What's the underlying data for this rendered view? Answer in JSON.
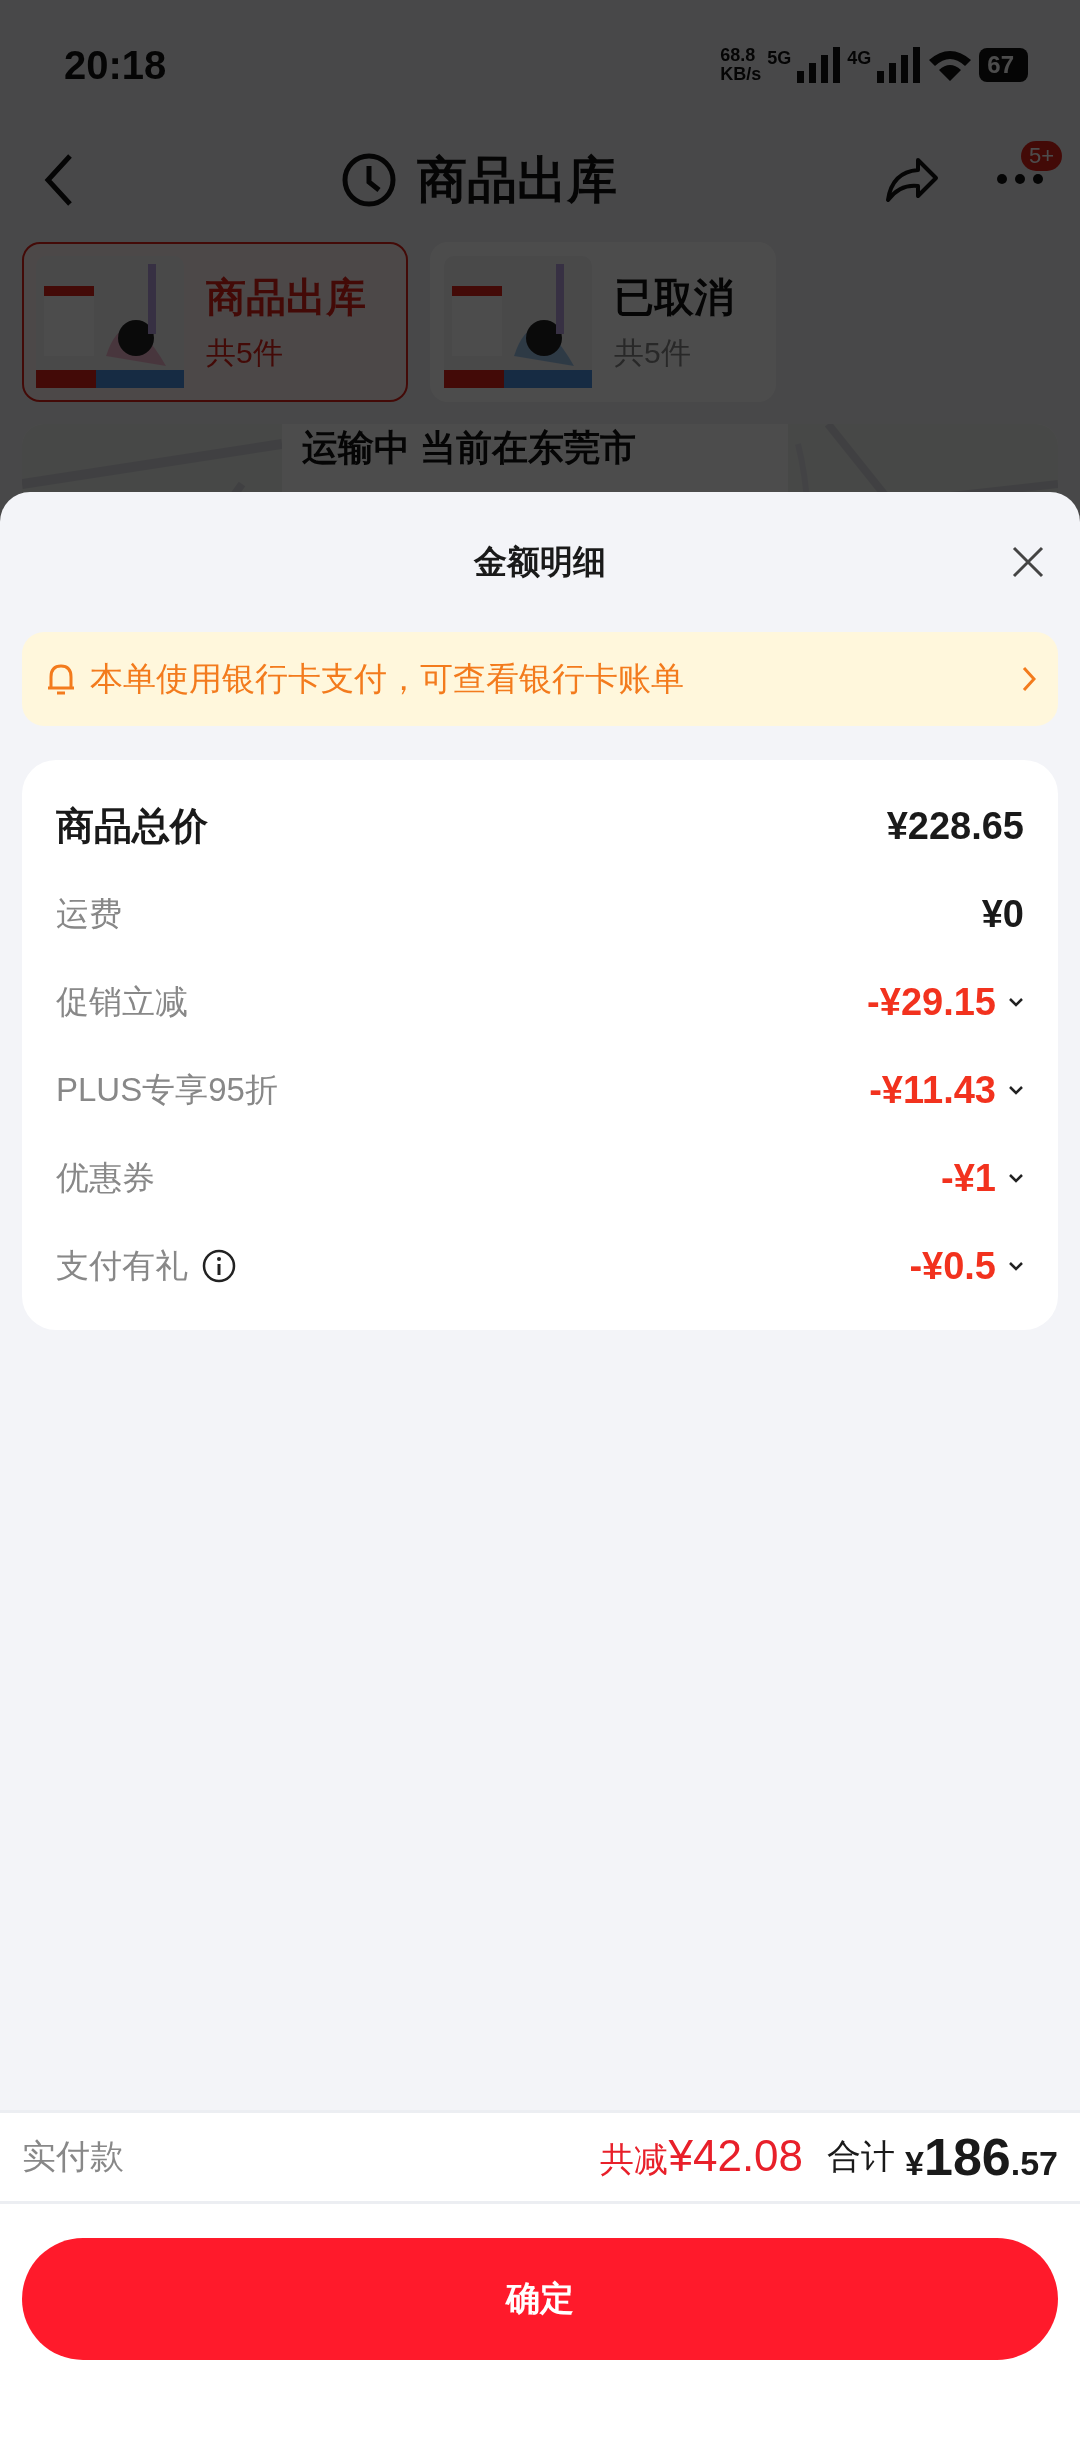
{
  "status_bar": {
    "time": "20:18",
    "speed_value": "68.8",
    "speed_unit": "KB/s",
    "sim1": "5G",
    "sim2": "4G",
    "battery": "67"
  },
  "header": {
    "title": "商品出库",
    "badge": "5+"
  },
  "packages": [
    {
      "title": "商品出库",
      "count": "共5件",
      "selected": true
    },
    {
      "title": "已取消",
      "count": "共5件",
      "selected": false
    }
  ],
  "shipment": {
    "status": "运输中 当前在东莞市"
  },
  "sheet": {
    "title": "金额明细",
    "notice": "本单使用银行卡支付，可查看银行卡账单",
    "rows": [
      {
        "kind": "total",
        "label": "商品总价",
        "amount": "¥228.65"
      },
      {
        "kind": "plain",
        "label": "运费",
        "amount": "¥0"
      },
      {
        "kind": "discount",
        "label": "促销立减",
        "amount": "-¥29.15"
      },
      {
        "kind": "discount",
        "label": "PLUS专享95折",
        "amount": "-¥11.43"
      },
      {
        "kind": "discount",
        "label": "优惠券",
        "amount": "-¥1"
      },
      {
        "kind": "discount",
        "label": "支付有礼",
        "amount": "-¥0.5",
        "info": true
      }
    ],
    "footer": {
      "label": "实付款",
      "saving_label": "共减",
      "saving_amount": "¥42.08",
      "total_label": "合计",
      "total_currency": "¥",
      "total_integer": "186",
      "total_decimal": ".57"
    },
    "confirm_button": "确定"
  }
}
